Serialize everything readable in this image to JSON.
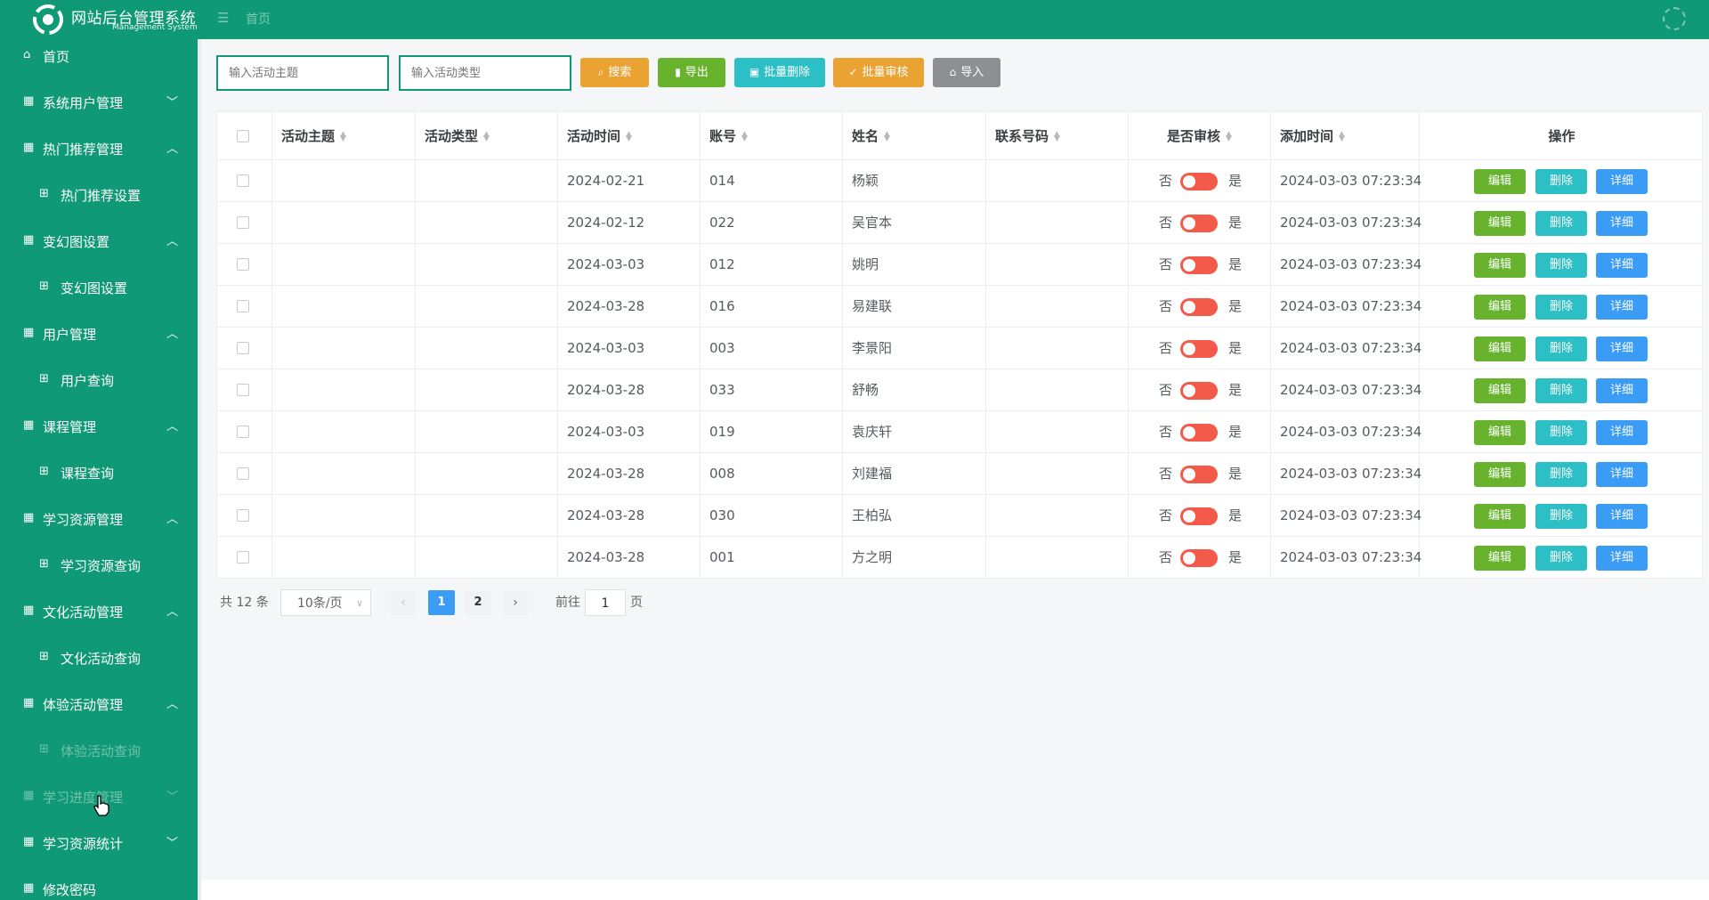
{
  "header": {
    "title": "网站后台管理系统",
    "subtitle": "Management System",
    "breadcrumb": "首页",
    "bg_color": "#109976"
  },
  "sidebar": {
    "items": [
      {
        "label": "首页",
        "icon": "home-icon",
        "level": 1
      },
      {
        "label": "系统用户管理",
        "icon": "grid-icon",
        "level": 1,
        "arrow": "down"
      },
      {
        "label": "热门推荐管理",
        "icon": "grid-icon",
        "level": 1,
        "arrow": "up"
      },
      {
        "label": "热门推荐设置",
        "icon": "apps-icon",
        "level": 2
      },
      {
        "label": "变幻图设置",
        "icon": "grid-icon",
        "level": 1,
        "arrow": "up"
      },
      {
        "label": "变幻图设置",
        "icon": "apps-icon",
        "level": 2
      },
      {
        "label": "用户管理",
        "icon": "grid-icon",
        "level": 1,
        "arrow": "up"
      },
      {
        "label": "用户查询",
        "icon": "apps-icon",
        "level": 2
      },
      {
        "label": "课程管理",
        "icon": "grid-icon",
        "level": 1,
        "arrow": "up"
      },
      {
        "label": "课程查询",
        "icon": "apps-icon",
        "level": 2
      },
      {
        "label": "学习资源管理",
        "icon": "grid-icon",
        "level": 1,
        "arrow": "up"
      },
      {
        "label": "学习资源查询",
        "icon": "apps-icon",
        "level": 2
      },
      {
        "label": "文化活动管理",
        "icon": "grid-icon",
        "level": 1,
        "arrow": "up"
      },
      {
        "label": "文化活动查询",
        "icon": "apps-icon",
        "level": 2
      },
      {
        "label": "体验活动管理",
        "icon": "grid-icon",
        "level": 1,
        "arrow": "up"
      },
      {
        "label": "体验活动查询",
        "icon": "apps-icon",
        "level": 2
      },
      {
        "label": "学习进度管理",
        "icon": "grid-icon",
        "level": 1,
        "arrow": "down"
      },
      {
        "label": "学习资源统计",
        "icon": "grid-icon",
        "level": 1,
        "arrow": "down"
      },
      {
        "label": "修改密码",
        "icon": "grid-icon",
        "level": 1
      }
    ]
  },
  "search": {
    "topic_placeholder": "输入活动主题",
    "type_placeholder": "输入活动类型"
  },
  "toolbar": {
    "search_label": "搜索",
    "export_label": "导出",
    "batch_delete_label": "批量删除",
    "batch_audit_label": "批量审核",
    "import_label": "导入"
  },
  "table": {
    "columns": [
      "活动主题",
      "活动类型",
      "活动时间",
      "账号",
      "姓名",
      "联系号码",
      "是否审核",
      "添加时间",
      "操作"
    ],
    "toggle_no": "否",
    "toggle_yes": "是",
    "action_edit": "编辑",
    "action_delete": "删除",
    "action_detail": "详细",
    "rows": [
      {
        "topic": "",
        "type": "",
        "time": "2024-02-21",
        "account": "014",
        "name": "杨颖",
        "phone": "",
        "added": "2024-03-03 07:23:34"
      },
      {
        "topic": "",
        "type": "",
        "time": "2024-02-12",
        "account": "022",
        "name": "吴官本",
        "phone": "",
        "added": "2024-03-03 07:23:34"
      },
      {
        "topic": "",
        "type": "",
        "time": "2024-03-03",
        "account": "012",
        "name": "姚明",
        "phone": "",
        "added": "2024-03-03 07:23:34"
      },
      {
        "topic": "",
        "type": "",
        "time": "2024-03-28",
        "account": "016",
        "name": "易建联",
        "phone": "",
        "added": "2024-03-03 07:23:34"
      },
      {
        "topic": "",
        "type": "",
        "time": "2024-03-03",
        "account": "003",
        "name": "李景阳",
        "phone": "",
        "added": "2024-03-03 07:23:34"
      },
      {
        "topic": "",
        "type": "",
        "time": "2024-03-28",
        "account": "033",
        "name": "舒畅",
        "phone": "",
        "added": "2024-03-03 07:23:34"
      },
      {
        "topic": "",
        "type": "",
        "time": "2024-03-03",
        "account": "019",
        "name": "袁庆轩",
        "phone": "",
        "added": "2024-03-03 07:23:34"
      },
      {
        "topic": "",
        "type": "",
        "time": "2024-03-28",
        "account": "008",
        "name": "刘建福",
        "phone": "",
        "added": "2024-03-03 07:23:34"
      },
      {
        "topic": "",
        "type": "",
        "time": "2024-03-28",
        "account": "030",
        "name": "王柏弘",
        "phone": "",
        "added": "2024-03-03 07:23:34"
      },
      {
        "topic": "",
        "type": "",
        "time": "2024-03-28",
        "account": "001",
        "name": "方之明",
        "phone": "",
        "added": "2024-03-03 07:23:34"
      }
    ]
  },
  "pagination": {
    "total": "共 12 条",
    "page_size": "10条/页",
    "pages": [
      "1",
      "2"
    ],
    "current": "1",
    "goto_prefix": "前往",
    "goto_value": "1",
    "goto_suffix": "页"
  }
}
